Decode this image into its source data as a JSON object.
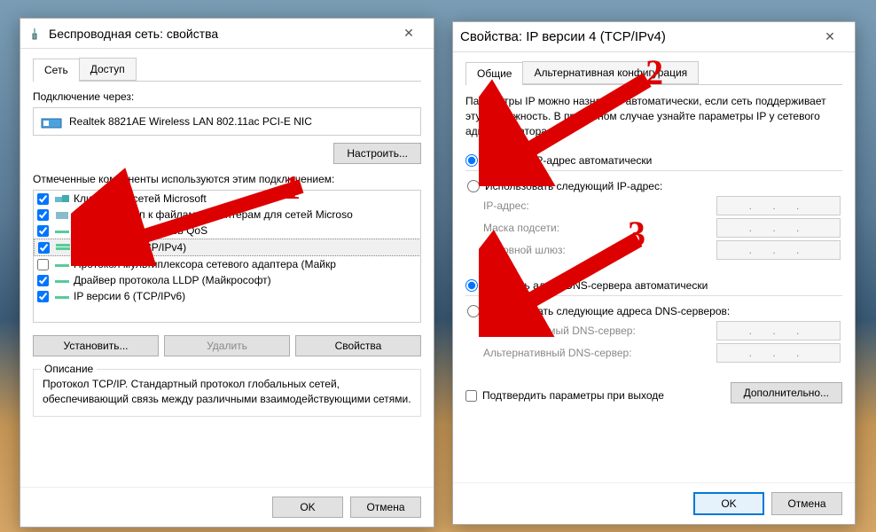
{
  "win1": {
    "title": "Беспроводная сеть: свойства",
    "tabs": {
      "network": "Сеть",
      "access": "Доступ"
    },
    "connect_via": "Подключение через:",
    "adapter": "Realtek 8821AE Wireless LAN 802.11ac PCI-E NIC",
    "configure": "Настроить...",
    "components_label": "Отмеченные компоненты используются этим подключением:",
    "items": [
      {
        "label": "Клиент для сетей Microsoft",
        "checked": true
      },
      {
        "label": "Общий доступ к файлам и принтерам для сетей Microso",
        "checked": true
      },
      {
        "label": "Планировщик пакетов QoS",
        "checked": true
      },
      {
        "label": "IP версии 4 (TCP/IPv4)",
        "checked": true
      },
      {
        "label": "Протокол мультиплексора сетевого адаптера (Майкр",
        "checked": false
      },
      {
        "label": "Драйвер протокола LLDP (Майкрософт)",
        "checked": true
      },
      {
        "label": "IP версии 6 (TCP/IPv6)",
        "checked": true
      }
    ],
    "install": "Установить...",
    "remove": "Удалить",
    "properties": "Свойства",
    "description_title": "Описание",
    "description": "Протокол TCP/IP. Стандартный протокол глобальных сетей, обеспечивающий связь между различными взаимодействующими сетями.",
    "ok": "OK",
    "cancel": "Отмена"
  },
  "win2": {
    "title": "Свойства: IP версии 4 (TCP/IPv4)",
    "tabs": {
      "general": "Общие",
      "alt": "Альтернативная конфигурация"
    },
    "info": "Параметры IP можно назначать автоматически, если сеть поддерживает эту возможность. В противном случае узнайте параметры IP у сетевого администратора.",
    "ip_auto": "Получить IP-адрес автоматически",
    "ip_manual": "Использовать следующий IP-адрес:",
    "ip_address": "IP-адрес:",
    "subnet": "Маска подсети:",
    "gateway": "Основной шлюз:",
    "dns_auto": "Получить адрес DNS-сервера автоматически",
    "dns_manual": "Использовать следующие адреса DNS-серверов:",
    "dns_pref": "Предпочитаемый DNS-сервер:",
    "dns_alt": "Альтернативный DNS-сервер:",
    "confirm": "Подтвердить параметры при выходе",
    "advanced": "Дополнительно...",
    "ok": "OK",
    "cancel": "Отмена",
    "dots": ".    .    ."
  },
  "annotations": {
    "n1": "1",
    "n2": "2",
    "n3": "3"
  }
}
